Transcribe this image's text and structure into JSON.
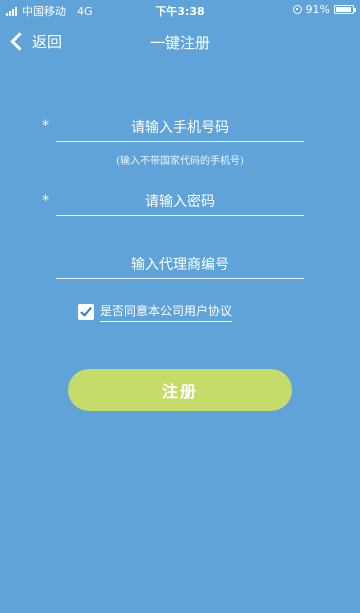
{
  "status_bar": {
    "carrier": "中国移动",
    "network": "4G",
    "time": "下午3:38",
    "battery_text": "91%",
    "battery_level": 0.91
  },
  "nav": {
    "back_label": "返回",
    "title": "一键注册"
  },
  "form": {
    "phone": {
      "placeholder": "请输入手机号码",
      "required_mark": "*",
      "hint": "(输入不带国家代码的手机号)"
    },
    "password": {
      "placeholder": "请输入密码",
      "required_mark": "*"
    },
    "agent_code": {
      "placeholder": "输入代理商编号"
    },
    "agreement": {
      "checked": true,
      "label": "是否同意本公司用户协议"
    },
    "submit_label": "注册"
  },
  "colors": {
    "background": "#5fa3d8",
    "button": "#c6dc6a",
    "text": "#ffffff"
  }
}
